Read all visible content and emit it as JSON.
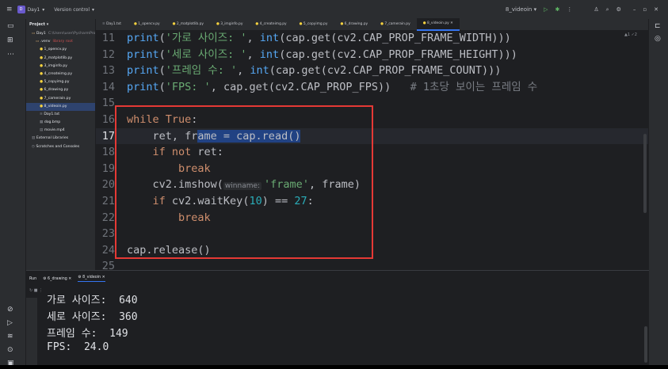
{
  "titlebar": {
    "project_badge": "D",
    "project": "Day1",
    "vcs": "Version control",
    "run_config": "8_videoin",
    "run_icon": "play-icon",
    "debug_icon": "bug-icon"
  },
  "project_panel": {
    "title": "Project",
    "items": [
      {
        "label": "Day1",
        "extra": "C:\\Users\\user\\PycharmProjects\\Day1",
        "indent": 1,
        "kind": "folder"
      },
      {
        "label": ".venv",
        "extra": "library root",
        "indent": 2,
        "kind": "folder"
      },
      {
        "label": "1_opencv.py",
        "extra": "",
        "indent": 3,
        "kind": "py"
      },
      {
        "label": "2_matplotlib.py",
        "extra": "",
        "indent": 3,
        "kind": "py"
      },
      {
        "label": "3_imginfo.py",
        "extra": "",
        "indent": 3,
        "kind": "py"
      },
      {
        "label": "4_createimg.py",
        "extra": "",
        "indent": 3,
        "kind": "py"
      },
      {
        "label": "5_copyimg.py",
        "extra": "",
        "indent": 3,
        "kind": "py"
      },
      {
        "label": "6_drawing.py",
        "extra": "",
        "indent": 3,
        "kind": "py"
      },
      {
        "label": "7_camerain.py",
        "extra": "",
        "indent": 3,
        "kind": "py"
      },
      {
        "label": "8_videoin.py",
        "extra": "",
        "indent": 3,
        "kind": "py"
      },
      {
        "label": "Day1.txt",
        "extra": "",
        "indent": 3,
        "kind": "txt"
      },
      {
        "label": "dog.bmp",
        "extra": "",
        "indent": 3,
        "kind": "img"
      },
      {
        "label": "movie.mp4",
        "extra": "",
        "indent": 3,
        "kind": "mp4"
      },
      {
        "label": "External Libraries",
        "extra": "",
        "indent": 1,
        "kind": "lib"
      },
      {
        "label": "Scratches and Consoles",
        "extra": "",
        "indent": 1,
        "kind": "scratch"
      }
    ]
  },
  "tabs": [
    "Day1.txt",
    "1_opencv.py",
    "2_matplotlib.py",
    "3_imginfo.py",
    "4_createimg.py",
    "5_copyimg.py",
    "6_drawing.py",
    "7_camerain.py",
    "8_videoin.py"
  ],
  "active_tab": "8_videoin.py",
  "inspection": "▲1 ✓2",
  "code": [
    {
      "n": "11",
      "tokens": [
        [
          "fn",
          "print"
        ],
        [
          "pl",
          "("
        ],
        [
          "str",
          "'가로 사이즈: '"
        ],
        [
          "pl",
          ", "
        ],
        [
          "fn",
          "int"
        ],
        [
          "pl",
          "(cap.get(cv2.CAP_PROP_FRAME_WIDTH)))"
        ]
      ]
    },
    {
      "n": "12",
      "tokens": [
        [
          "fn",
          "print"
        ],
        [
          "pl",
          "("
        ],
        [
          "str",
          "'세로 사이즈: '"
        ],
        [
          "pl",
          ", "
        ],
        [
          "fn",
          "int"
        ],
        [
          "pl",
          "(cap.get(cv2.CAP_PROP_FRAME_HEIGHT)))"
        ]
      ]
    },
    {
      "n": "13",
      "tokens": [
        [
          "fn",
          "print"
        ],
        [
          "pl",
          "("
        ],
        [
          "str",
          "'프레임 수: '"
        ],
        [
          "pl",
          ", "
        ],
        [
          "fn",
          "int"
        ],
        [
          "pl",
          "(cap.get(cv2.CAP_PROP_FRAME_COUNT)))"
        ]
      ]
    },
    {
      "n": "14",
      "tokens": [
        [
          "fn",
          "print"
        ],
        [
          "pl",
          "("
        ],
        [
          "str",
          "'FPS: '"
        ],
        [
          "pl",
          ", cap.get(cv2.CAP_PROP_FPS))   "
        ],
        [
          "cm",
          "# 1초당 보이는 프레임 수"
        ]
      ]
    },
    {
      "n": "15",
      "tokens": []
    },
    {
      "n": "16",
      "tokens": [
        [
          "kw",
          "while"
        ],
        [
          "pl",
          " "
        ],
        [
          "kw",
          "True"
        ],
        [
          "pl",
          ":"
        ]
      ]
    },
    {
      "n": "17",
      "tokens": [
        [
          "pl",
          "    ret, fr"
        ],
        [
          "sel",
          "ame = cap.read()"
        ]
      ]
    },
    {
      "n": "18",
      "tokens": [
        [
          "pl",
          "    "
        ],
        [
          "kw",
          "if not"
        ],
        [
          "pl",
          " ret:"
        ]
      ]
    },
    {
      "n": "19",
      "tokens": [
        [
          "pl",
          "        "
        ],
        [
          "kw",
          "break"
        ]
      ]
    },
    {
      "n": "20",
      "tokens": [
        [
          "pl",
          "    cv2.imshow("
        ],
        [
          "hint",
          "winname:"
        ],
        [
          "str",
          "'frame'"
        ],
        [
          "pl",
          ", frame)"
        ]
      ]
    },
    {
      "n": "21",
      "tokens": [
        [
          "pl",
          "    "
        ],
        [
          "kw",
          "if"
        ],
        [
          "pl",
          " cv2.waitKey("
        ],
        [
          "num",
          "10"
        ],
        [
          "pl",
          ") == "
        ],
        [
          "num",
          "27"
        ],
        [
          "pl",
          ":"
        ]
      ]
    },
    {
      "n": "22",
      "tokens": [
        [
          "pl",
          "        "
        ],
        [
          "kw",
          "break"
        ]
      ]
    },
    {
      "n": "23",
      "tokens": []
    },
    {
      "n": "24",
      "tokens": [
        [
          "pl",
          "cap.release()"
        ]
      ]
    },
    {
      "n": "25",
      "tokens": []
    }
  ],
  "current_line": "17",
  "run_panel": {
    "label": "Run",
    "tabs": [
      "6_drawing",
      "8_videoin"
    ],
    "active": "8_videoin"
  },
  "output": [
    "가로 사이즈:  640",
    "세로 사이즈:  360",
    "프레임 수:  149",
    "FPS:  24.0"
  ],
  "colors": {
    "accent": "#3574f0",
    "highlight_box": "#e53935"
  }
}
